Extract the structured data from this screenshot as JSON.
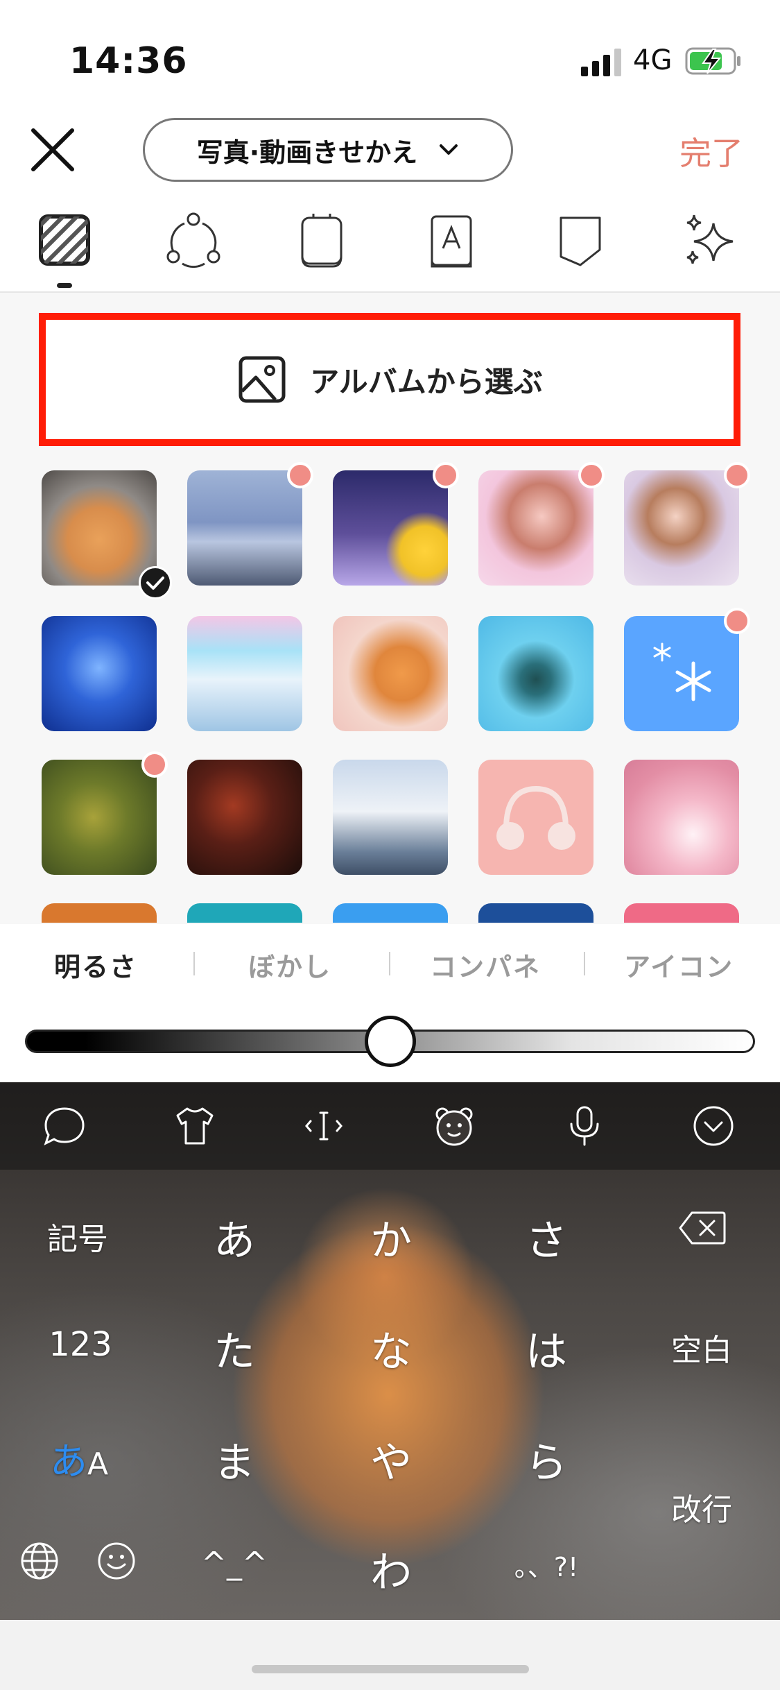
{
  "status": {
    "time": "14:36",
    "network": "4G"
  },
  "header": {
    "mode_label": "写真·動画きせかえ",
    "done_label": "完了"
  },
  "album_button": {
    "label": "アルバムから選ぶ"
  },
  "adjust_tabs": [
    "明るさ",
    "ぼかし",
    "コンパネ",
    "アイコン"
  ],
  "brightness_level": 0.5,
  "keyboard": {
    "left_keys": [
      "記号",
      "123"
    ],
    "input_mode": {
      "primary": "あ",
      "secondary": "A"
    },
    "kana_rows": [
      [
        "あ",
        "か",
        "さ"
      ],
      [
        "た",
        "な",
        "は"
      ],
      [
        "ま",
        "や",
        "ら"
      ],
      [
        "^_^",
        "わ",
        "。、?!"
      ]
    ],
    "space_label": "空白",
    "return_label": "改行"
  },
  "colors": {
    "accent": "#e47e6e",
    "highlight": "#ff1d07",
    "badge": "#f08d86",
    "mode_blue": "#2d8cf0"
  }
}
